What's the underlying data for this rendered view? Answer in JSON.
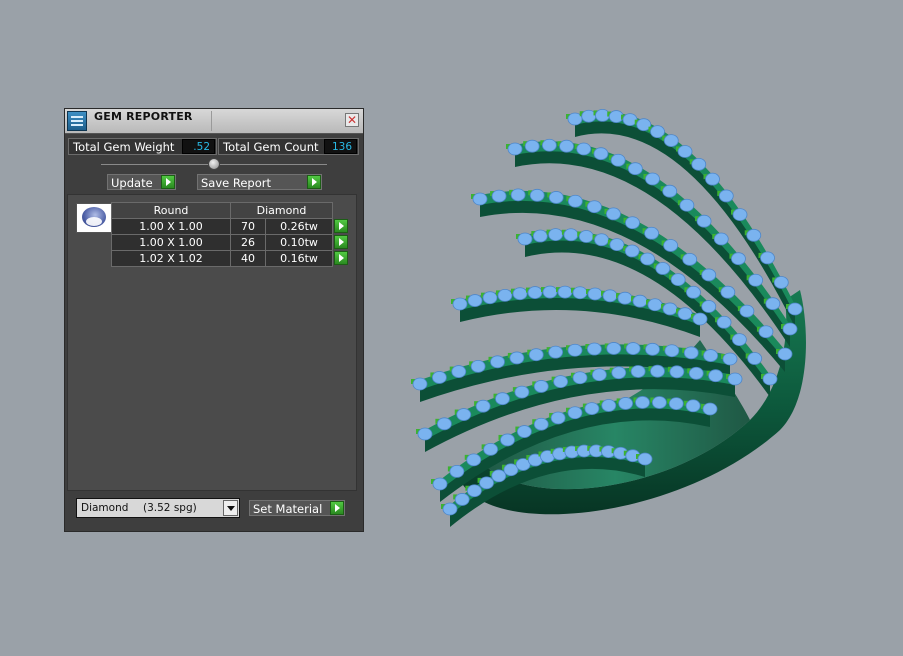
{
  "panel": {
    "title": "GEM REPORTER",
    "total_weight_label": "Total Gem Weight",
    "total_weight_value": ".52",
    "total_count_label": "Total Gem Count",
    "total_count_value": "136",
    "update_label": "Update",
    "save_report_label": "Save Report",
    "table": {
      "header_shape": "Round",
      "header_material": "Diamond",
      "rows": [
        {
          "size": "1.00 X 1.00",
          "count": "70",
          "weight": "0.26tw"
        },
        {
          "size": "1.00 X 1.00",
          "count": "26",
          "weight": "0.10tw"
        },
        {
          "size": "1.02 X 1.02",
          "count": "40",
          "weight": "0.16tw"
        }
      ]
    },
    "material": {
      "name": "Diamond",
      "spg": "(3.52 spg)"
    },
    "set_material_label": "Set Material"
  },
  "colors": {
    "viewport_bg": "#9aa1a8",
    "ring_metal": "#0f5e43",
    "gems": "#7ab3ef",
    "accent_green": "#3cb232",
    "value_text": "#29b9e5"
  },
  "icons": {
    "app": "gem-reporter-app-icon",
    "close": "close-icon",
    "go": "green-play-arrow-icon",
    "dropdown": "chevron-down-icon",
    "gem": "round-gem-icon"
  }
}
